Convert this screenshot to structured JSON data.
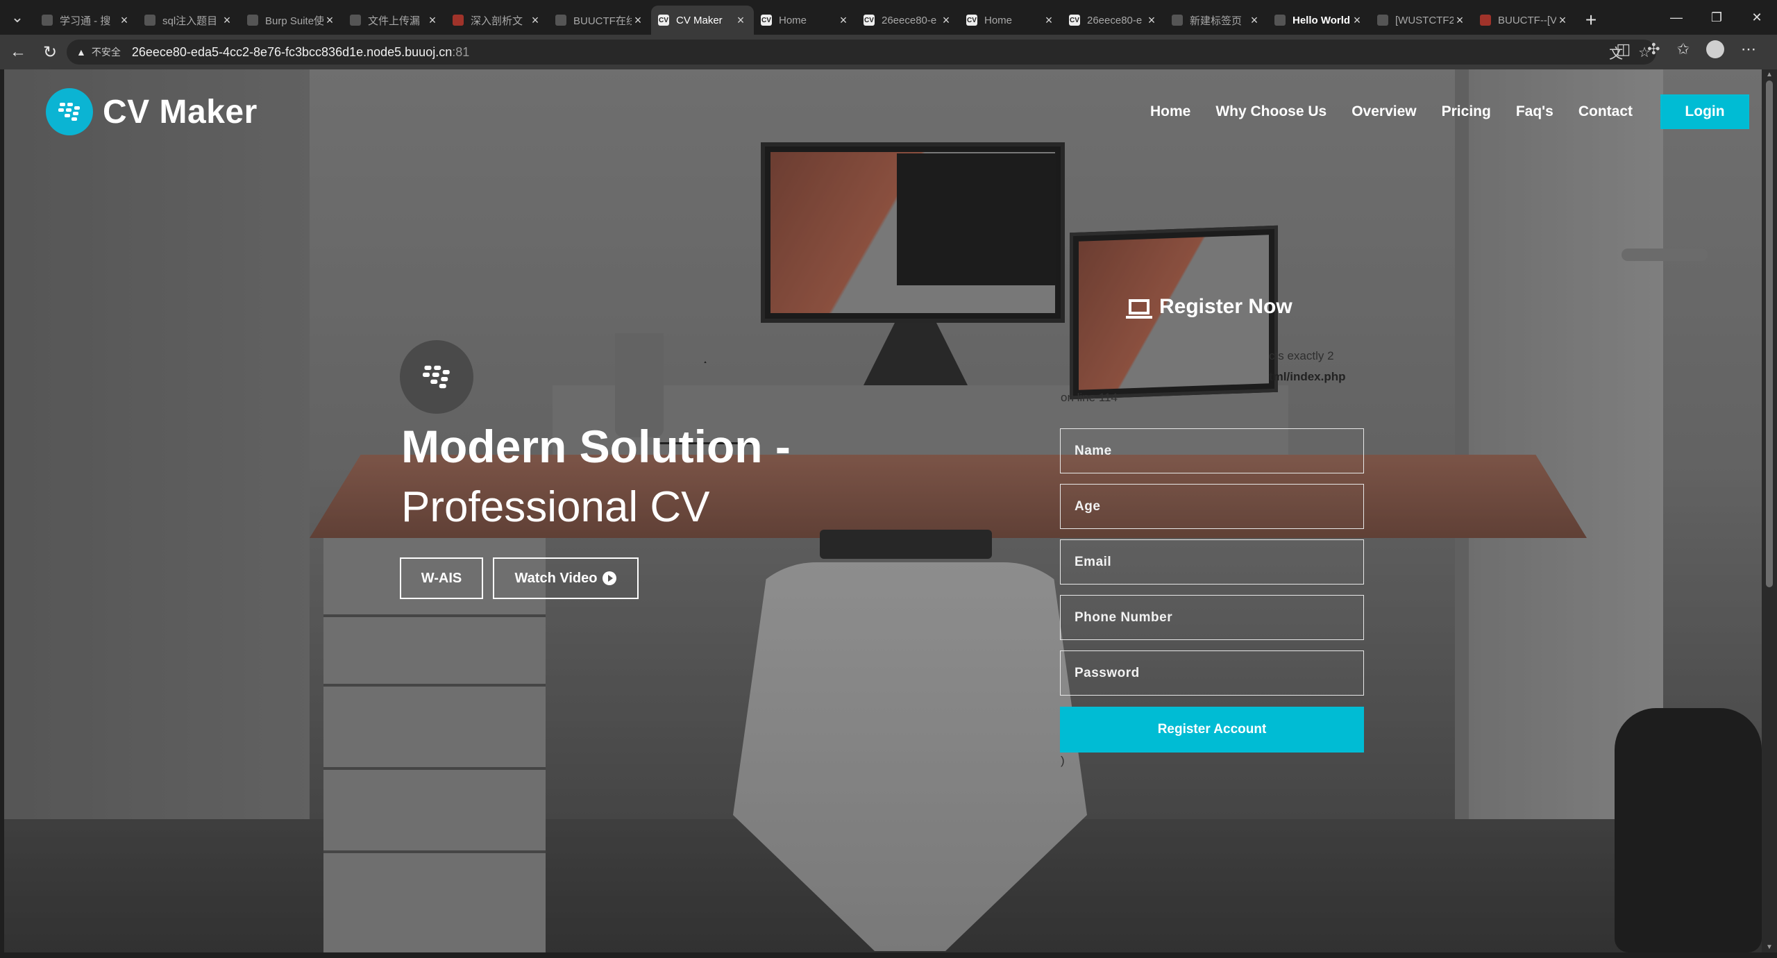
{
  "browser": {
    "tabs": [
      {
        "label": "学习通 - 搜",
        "icon": "search-icon"
      },
      {
        "label": "sql注入题目",
        "icon": "mountain-icon"
      },
      {
        "label": "Burp Suite使",
        "icon": "mountain-icon"
      },
      {
        "label": "文件上传漏",
        "icon": "search-icon"
      },
      {
        "label": "深入剖析文",
        "icon": "red-c-icon"
      },
      {
        "label": "BUUCTF在线",
        "icon": "mc-icon"
      },
      {
        "label": "CV Maker",
        "icon": "cv-icon",
        "active": true
      },
      {
        "label": "Home",
        "icon": "cv-icon"
      },
      {
        "label": "26eece80-e",
        "icon": "cv-icon"
      },
      {
        "label": "Home",
        "icon": "cv-icon"
      },
      {
        "label": "26eece80-e",
        "icon": "cv-icon"
      },
      {
        "label": "新建标签页",
        "icon": "page-icon"
      },
      {
        "label": "Hello World",
        "icon": "mountain-icon"
      },
      {
        "label": "[WUSTCTF2",
        "icon": "search-icon"
      },
      {
        "label": "BUUCTF--[V",
        "icon": "red-c-icon"
      }
    ],
    "insecure_label": "不安全",
    "url_host": "26eece80-eda5-4cc2-8e76-fc3bcc836d1e.node5.buuoj.cn",
    "url_port": ":81"
  },
  "site": {
    "brand": "CV Maker",
    "nav": [
      "Home",
      "Why Choose Us",
      "Overview",
      "Pricing",
      "Faq's",
      "Contact"
    ],
    "login": "Login",
    "accent": "#00bcd4"
  },
  "hero": {
    "title": "Modern Solution -",
    "subtitle": "Professional CV",
    "btn_primary": "W-AIS",
    "btn_secondary": "Watch Video"
  },
  "register": {
    "title": "Register Now",
    "warning_line1": "cts exactly 2",
    "warning_line2_pre": "",
    "warning_file": "tml/index.php",
    "warning_line3": "on line 114",
    "fields": {
      "name": "Name",
      "age": "Age",
      "email": "Email",
      "phone": "Phone Number",
      "password": "Password"
    },
    "submit": "Register Account",
    "trailing": ")"
  }
}
